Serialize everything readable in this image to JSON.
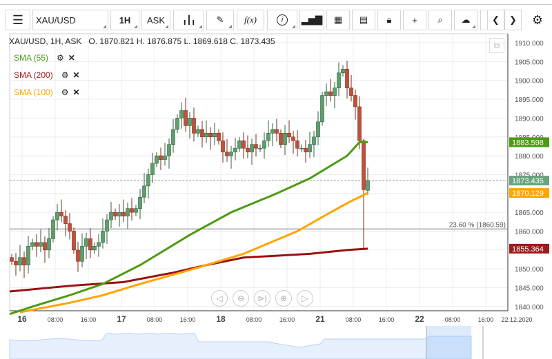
{
  "toolbar": {
    "symbol": "XAU/USD",
    "interval": "1H",
    "price_type": "ASK"
  },
  "info": {
    "title": "XAU/USD, 1H, ASK",
    "ohlc": "O. 1870.821 H. 1876.875 L. 1869.618 C. 1873.435"
  },
  "indicators": [
    {
      "label": "SMA (55)",
      "color": "#4d9a13"
    },
    {
      "label": "SMA (200)",
      "color": "#9b1c1c"
    },
    {
      "label": "SMA (100)",
      "color": "#ffa500"
    }
  ],
  "chart_data": {
    "type": "candlestick",
    "y_ticks": [
      "1910.000",
      "1905.000",
      "1900.000",
      "1895.000",
      "1890.000",
      "1885.000",
      "1880.000",
      "1875.000",
      "1870.000",
      "1865.000",
      "1860.000",
      "1855.000",
      "1850.000",
      "1845.000",
      "1840.000"
    ],
    "ylim": [
      1838,
      1912
    ],
    "x_ticks": [
      {
        "label": "16",
        "major": true,
        "i": 2.5
      },
      {
        "label": "08:00",
        "i": 10.5
      },
      {
        "label": "16:00",
        "i": 18.5
      },
      {
        "label": "17",
        "major": true,
        "i": 26.5
      },
      {
        "label": "08:00",
        "i": 34.5
      },
      {
        "label": "16:00",
        "i": 42.5
      },
      {
        "label": "18",
        "major": true,
        "i": 50.5
      },
      {
        "label": "08:00",
        "i": 58.5
      },
      {
        "label": "16:00",
        "i": 66.5
      },
      {
        "label": "21",
        "major": true,
        "i": 74.5
      },
      {
        "label": "08:00",
        "i": 82.5
      },
      {
        "label": "16:00",
        "i": 90.5
      },
      {
        "label": "22",
        "major": true,
        "i": 98.5
      },
      {
        "label": "08:00",
        "i": 106.5
      },
      {
        "label": "16:00",
        "i": 114.5
      },
      {
        "label": "22.12.2020",
        "i": 122
      }
    ],
    "closes": [
      1852,
      1851,
      1853,
      1851,
      1856,
      1857,
      1856,
      1857,
      1855,
      1858,
      1863,
      1865,
      1864,
      1862,
      1860,
      1855,
      1852,
      1856,
      1858,
      1855,
      1856,
      1857,
      1860,
      1863,
      1865,
      1864,
      1865,
      1864,
      1866,
      1865,
      1866,
      1869,
      1872,
      1875,
      1878,
      1880,
      1879,
      1880,
      1883,
      1887,
      1890,
      1892,
      1888,
      1890,
      1886,
      1887,
      1885,
      1886,
      1885,
      1886,
      1884,
      1881,
      1880,
      1881,
      1882,
      1884,
      1882,
      1881,
      1883,
      1882,
      1882,
      1884,
      1886,
      1887,
      1886,
      1883,
      1886,
      1885,
      1884,
      1882,
      1882,
      1881,
      1883,
      1885,
      1889,
      1896,
      1897,
      1896,
      1898,
      1902,
      1903,
      1898,
      1896,
      1893,
      1884,
      1871,
      1873.435
    ],
    "first_open": 1853,
    "last": {
      "open": 1870.821,
      "high": 1876.875,
      "low": 1869.618,
      "close": 1873.435
    },
    "sma55": [
      [
        -1,
        1838
      ],
      [
        5,
        1840
      ],
      [
        14,
        1843
      ],
      [
        22,
        1846
      ],
      [
        31,
        1851
      ],
      [
        43,
        1859
      ],
      [
        53,
        1865
      ],
      [
        64,
        1870
      ],
      [
        72,
        1874
      ],
      [
        81,
        1880
      ],
      [
        84,
        1883.6
      ],
      [
        86,
        1883.598
      ]
    ],
    "sma100": [
      [
        2,
        1838.5
      ],
      [
        14,
        1841
      ],
      [
        22,
        1843
      ],
      [
        31,
        1846
      ],
      [
        44,
        1850
      ],
      [
        56,
        1854
      ],
      [
        69,
        1860
      ],
      [
        77,
        1865
      ],
      [
        82,
        1868
      ],
      [
        86,
        1870.129
      ]
    ],
    "sma200": [
      [
        -1,
        1844
      ],
      [
        14,
        1845.5
      ],
      [
        27,
        1846.5
      ],
      [
        39,
        1849
      ],
      [
        47,
        1851
      ],
      [
        56,
        1853
      ],
      [
        72,
        1854
      ],
      [
        81,
        1855
      ],
      [
        86,
        1855.364
      ]
    ],
    "price_labels": [
      {
        "value": "1883.598",
        "v": 1883.598,
        "color": "#4d9a13"
      },
      {
        "value": "1873.435",
        "v": 1873.435,
        "color": "#6aa27f"
      },
      {
        "value": "1870.129",
        "v": 1870.129,
        "color": "#ffa500"
      },
      {
        "value": "1855.364",
        "v": 1855.364,
        "color": "#9b1c1c"
      }
    ],
    "fib": {
      "label": "23.60 % (1860.59)",
      "v": 1860.59
    },
    "current_price": 1873.435
  }
}
